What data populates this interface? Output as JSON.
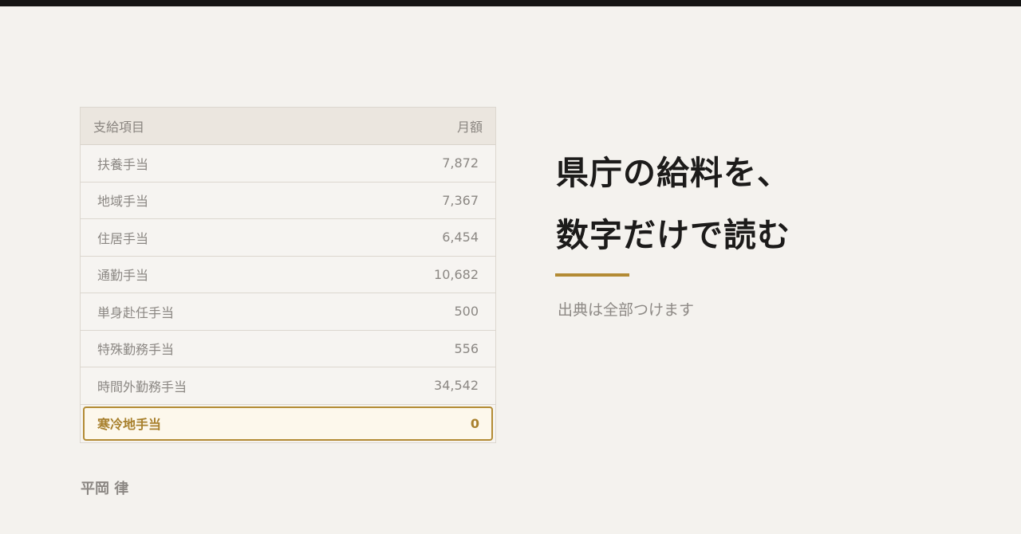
{
  "table": {
    "header": {
      "item_label": "支給項目",
      "amount_label": "月額"
    },
    "rows": [
      {
        "label": "扶養手当",
        "amount": "7,872"
      },
      {
        "label": "地域手当",
        "amount": "7,367"
      },
      {
        "label": "住居手当",
        "amount": "6,454"
      },
      {
        "label": "通勤手当",
        "amount": "10,682"
      },
      {
        "label": "単身赴任手当",
        "amount": "500"
      },
      {
        "label": "特殊勤務手当",
        "amount": "556"
      },
      {
        "label": "時間外勤務手当",
        "amount": "34,542"
      },
      {
        "label": "寒冷地手当",
        "amount": "0"
      }
    ]
  },
  "headline": {
    "line1": "県庁の給料を、",
    "line2": "数字だけで読む"
  },
  "subtitle": "出典は全部つけます",
  "author": "平岡 律",
  "colors": {
    "accent": "#b38b34",
    "background": "#f4f2ee",
    "top_bar": "#161514"
  }
}
